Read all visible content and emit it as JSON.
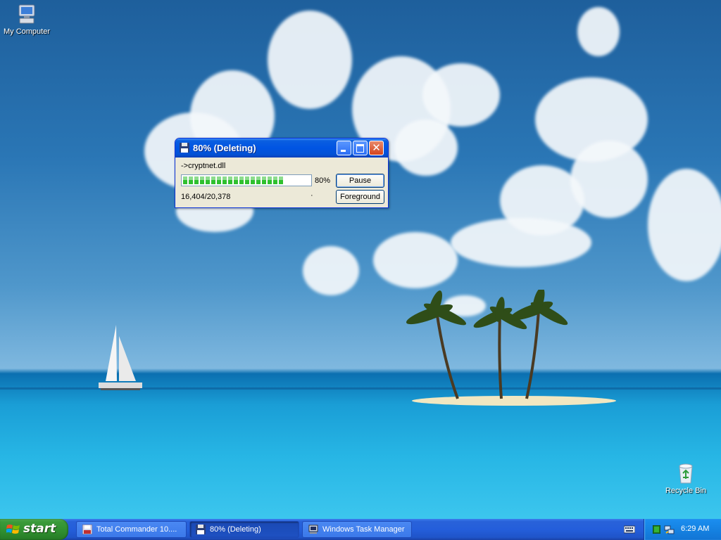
{
  "desktop": {
    "icons": [
      {
        "label": "My Computer",
        "icon": "my-computer-icon"
      },
      {
        "label": "Recycle Bin",
        "icon": "recycle-bin-icon"
      }
    ]
  },
  "progress_window": {
    "title": "80%  (Deleting)",
    "icon": "floppy-disk-icon",
    "file_name": "->cryptnet.dll",
    "progress": 0.8,
    "progress_label": "80%",
    "count_label": "16,404/20,378",
    "status_dot": "·",
    "buttons": {
      "pause": "Pause",
      "foreground": "Foreground"
    },
    "controls": {
      "close": "✕"
    }
  },
  "taskbar": {
    "start_label": "start",
    "tasks": [
      {
        "label": "Total Commander 10....",
        "icon": "total-commander-icon",
        "active": false
      },
      {
        "label": "80%  (Deleting)",
        "icon": "floppy-disk-icon",
        "active": true
      },
      {
        "label": "Windows Task Manager",
        "icon": "task-manager-icon",
        "active": false
      }
    ],
    "tray": {
      "clock": "6:29 AM"
    }
  },
  "colors": {
    "titlebar": "#0054e3",
    "progress_fill": "#2fc02f",
    "taskbar": "#245edb",
    "start_button": "#2f8e2f"
  }
}
